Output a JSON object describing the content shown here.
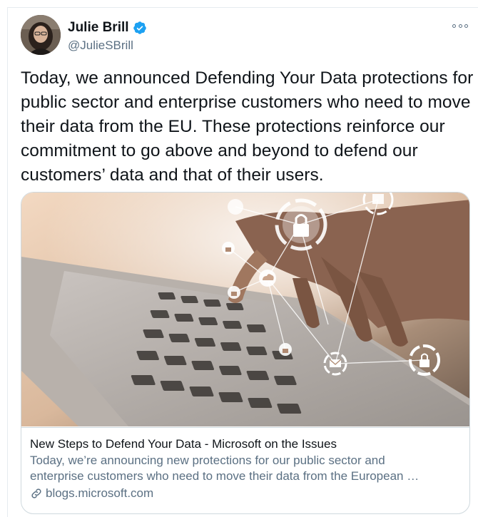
{
  "author": {
    "display_name": "Julie Brill",
    "handle": "@JulieSBrill",
    "verified": true,
    "avatar_icon": "profile-photo"
  },
  "more_icon": "more-options-icon",
  "tweet": {
    "text": "Today, we announced Defending Your Data protections for public sector and enterprise customers who need to move their data from the EU. These protections reinforce our commitment to go above and beyond to defend our customers’ data and that of their users."
  },
  "card": {
    "title": "New Steps to Defend Your Data - Microsoft on the Issues",
    "description_line1": "Today, we’re announcing new protections for our public sector and",
    "description_line2": "enterprise customers who need to move their data from the European …",
    "domain": "blogs.microsoft.com",
    "image_icons": [
      "lock-icon",
      "cloud-icon",
      "mail-icon",
      "server-icon"
    ]
  },
  "colors": {
    "text": "#0f1419",
    "secondary": "#5b7083",
    "verified": "#1da1f2",
    "border": "#cfd9de"
  }
}
